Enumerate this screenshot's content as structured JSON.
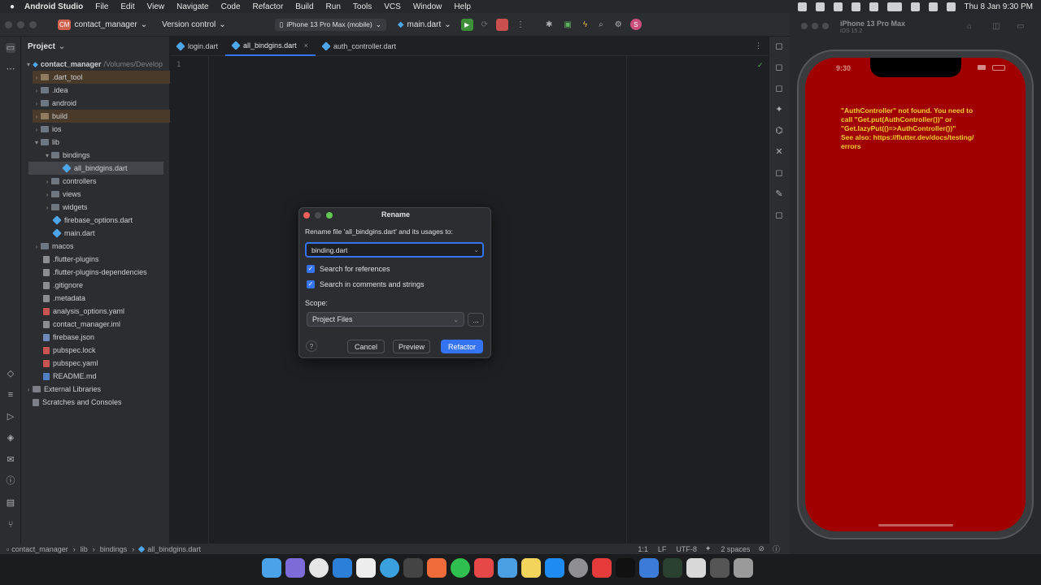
{
  "menubar": {
    "app": "Android Studio",
    "items": [
      "File",
      "Edit",
      "View",
      "Navigate",
      "Code",
      "Refactor",
      "Build",
      "Run",
      "Tools",
      "VCS",
      "Window",
      "Help"
    ],
    "clock": "Thu 8 Jan  9:30 PM"
  },
  "toolbar": {
    "project_badge": "CM",
    "project_name": "contact_manager",
    "vcs": "Version control",
    "device": "iPhone 13 Pro Max (mobile)",
    "run_config": "main.dart",
    "avatar": "S"
  },
  "tabs": [
    {
      "label": "login.dart"
    },
    {
      "label": "all_bindgins.dart"
    },
    {
      "label": "auth_controller.dart"
    }
  ],
  "project": {
    "title": "Project",
    "root_name": "contact_manager",
    "root_path": "/Volumes/Develop",
    "items": [
      {
        "label": ".dart_tool"
      },
      {
        "label": ".idea"
      },
      {
        "label": "android"
      },
      {
        "label": "build"
      },
      {
        "label": "ios"
      },
      {
        "label": "lib"
      },
      {
        "label": "bindings"
      },
      {
        "label": "all_bindgins.dart"
      },
      {
        "label": "controllers"
      },
      {
        "label": "views"
      },
      {
        "label": "widgets"
      },
      {
        "label": "firebase_options.dart"
      },
      {
        "label": "main.dart"
      },
      {
        "label": "macos"
      },
      {
        "label": ".flutter-plugins"
      },
      {
        "label": ".flutter-plugins-dependencies"
      },
      {
        "label": ".gitignore"
      },
      {
        "label": ".metadata"
      },
      {
        "label": "analysis_options.yaml"
      },
      {
        "label": "contact_manager.iml"
      },
      {
        "label": "firebase.json"
      },
      {
        "label": "pubspec.lock"
      },
      {
        "label": "pubspec.yaml"
      },
      {
        "label": "README.md"
      },
      {
        "label": "External Libraries"
      },
      {
        "label": "Scratches and Consoles"
      }
    ]
  },
  "editor": {
    "line_number": "1"
  },
  "dialog": {
    "title": "Rename",
    "prompt": "Rename file 'all_bindgins.dart' and its usages to:",
    "input_value": "binding.dart",
    "check1": "Search for references",
    "check2": "Search in comments and strings",
    "scope_label": "Scope:",
    "scope_value": "Project Files",
    "ellipsis": "...",
    "help": "?",
    "cancel": "Cancel",
    "preview": "Preview",
    "refactor": "Refactor"
  },
  "statusbar": {
    "crumbs": [
      "contact_manager",
      "lib",
      "bindings",
      "all_bindgins.dart"
    ],
    "position": "1:1",
    "line_sep": "LF",
    "encoding": "UTF-8",
    "indent": "2 spaces"
  },
  "simulator": {
    "title": "iPhone 13 Pro Max",
    "subtitle": "iOS 15.2",
    "time": "9:30",
    "error_lines": [
      "\"AuthController\" not found. You need to",
      "call \"Get.put(AuthController())\" or",
      "\"Get.lazyPut(()=>AuthController())\"",
      "See also: https://flutter.dev/docs/testing/",
      "errors"
    ]
  },
  "colors": {
    "accent": "#3574f0",
    "error_bg": "#a10000",
    "error_text": "#f2cf2f"
  }
}
